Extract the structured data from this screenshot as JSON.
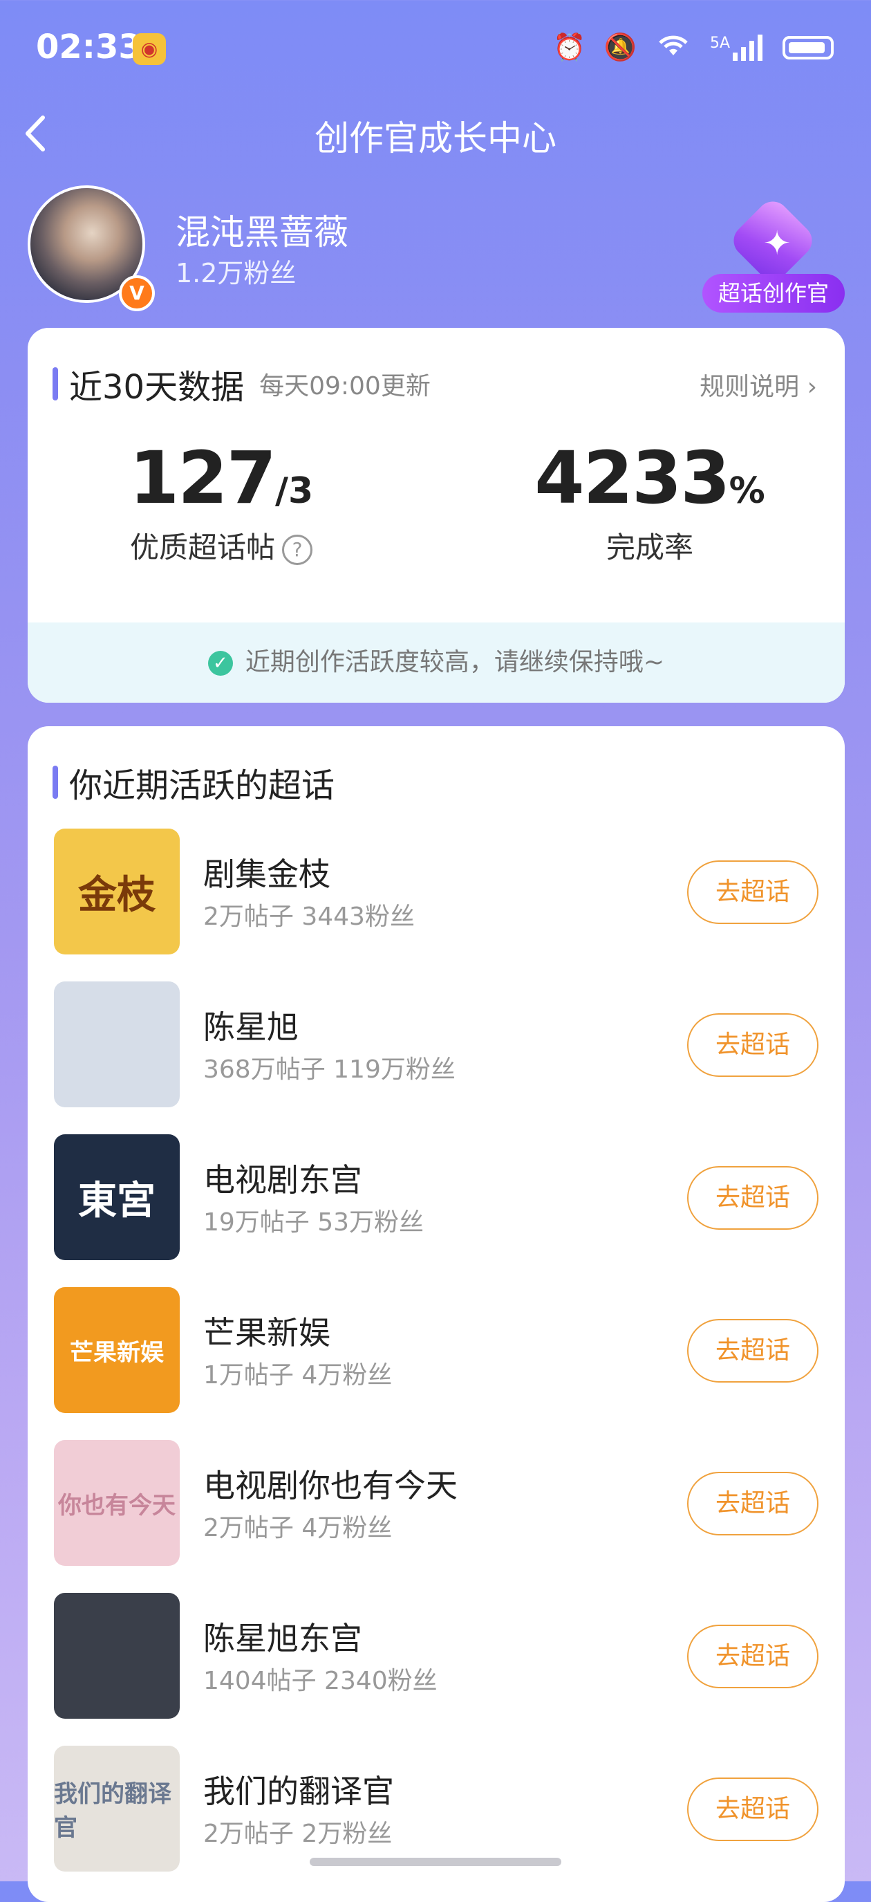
{
  "status_bar": {
    "time": "02:33",
    "network_label": "5A"
  },
  "nav": {
    "title": "创作官成长中心"
  },
  "profile": {
    "name": "混沌黑蔷薇",
    "fans": "1.2万粉丝",
    "verified_mark": "V",
    "badge_label": "超话创作官"
  },
  "stats_card": {
    "title": "近30天数据",
    "update_note": "每天09:00更新",
    "rules_link": "规则说明 ›",
    "quality_posts": {
      "value": "127",
      "suffix": "/3",
      "label": "优质超话帖",
      "help": "?"
    },
    "completion_rate": {
      "value": "4233",
      "suffix": "%",
      "label": "完成率"
    },
    "notice": "近期创作活跃度较高，请继续保持哦~"
  },
  "active_topics": {
    "title": "你近期活跃的超话",
    "button_label": "去超话",
    "items": [
      {
        "name": "剧集金枝",
        "meta": "2万帖子 3443粉丝",
        "thumb_text": "金枝",
        "thumb_bg": "#f3c74a",
        "thumb_fg": "#7a3a0a"
      },
      {
        "name": "陈星旭",
        "meta": "368万帖子 119万粉丝",
        "thumb_text": "",
        "thumb_bg": "#d6dde8",
        "thumb_fg": "#333"
      },
      {
        "name": "电视剧东宫",
        "meta": "19万帖子 53万粉丝",
        "thumb_text": "東宮",
        "thumb_bg": "#1f2d44",
        "thumb_fg": "#ffffff"
      },
      {
        "name": "芒果新娱",
        "meta": "1万帖子 4万粉丝",
        "thumb_text": "芒果新娱",
        "thumb_bg": "#f29a1f",
        "thumb_fg": "#ffffff"
      },
      {
        "name": "电视剧你也有今天",
        "meta": "2万帖子 4万粉丝",
        "thumb_text": "你也有今天",
        "thumb_bg": "#f1cdd6",
        "thumb_fg": "#c7859a"
      },
      {
        "name": "陈星旭东宫",
        "meta": "1404帖子 2340粉丝",
        "thumb_text": "",
        "thumb_bg": "#3a3f4a",
        "thumb_fg": "#fff"
      },
      {
        "name": "我们的翻译官",
        "meta": "2万帖子 2万粉丝",
        "thumb_text": "我们的翻译官",
        "thumb_bg": "#e6e2dc",
        "thumb_fg": "#6a7890"
      }
    ]
  },
  "colors": {
    "accent_bar": "#7a7bf2",
    "button_orange": "#f0932b",
    "verified_orange": "#ff7a1a",
    "check_green": "#3cc59e"
  }
}
